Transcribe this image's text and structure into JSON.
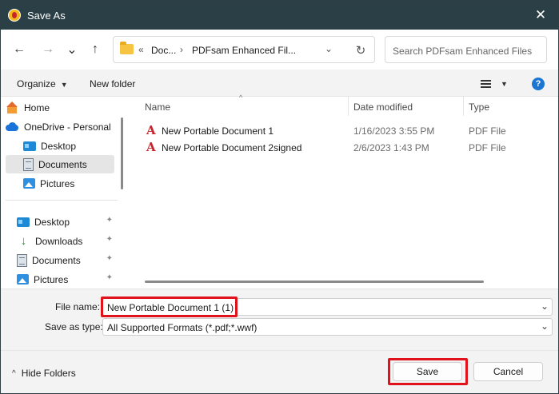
{
  "window": {
    "title": "Save As",
    "close_glyph": "✕",
    "app_icon": "pdfsam-icon"
  },
  "nav": {
    "back_glyph": "←",
    "forward_glyph": "→",
    "recent_glyph": "⌄",
    "up_glyph": "↑",
    "breadcrumb_overflow": "«",
    "breadcrumbs": [
      "Doc...",
      "PDFsam Enhanced Fil..."
    ],
    "breadcrumb_separator": "›",
    "address_dropdown_glyph": "⌄",
    "refresh_glyph": "↻",
    "search_placeholder": "Search PDFsam Enhanced Files"
  },
  "commands": {
    "organize": "Organize",
    "organize_caret": "▼",
    "new_folder": "New folder",
    "view_caret": "▼",
    "help": "?"
  },
  "sidebar": {
    "items": [
      {
        "label": "Home",
        "icon": "home-icon"
      },
      {
        "label": "OneDrive - Personal",
        "icon": "onedrive-icon"
      },
      {
        "label": "Desktop",
        "icon": "desktop-icon"
      },
      {
        "label": "Documents",
        "icon": "documents-icon",
        "selected": true
      },
      {
        "label": "Pictures",
        "icon": "pictures-icon"
      }
    ],
    "quick_access": [
      {
        "label": "Desktop",
        "icon": "desktop-icon",
        "pinned": true
      },
      {
        "label": "Downloads",
        "icon": "downloads-icon",
        "pinned": true
      },
      {
        "label": "Documents",
        "icon": "documents-icon",
        "pinned": true
      },
      {
        "label": "Pictures",
        "icon": "pictures-icon",
        "pinned": true
      }
    ],
    "pin_glyph": "📌"
  },
  "filelist": {
    "columns": [
      "Name",
      "Date modified",
      "Type"
    ],
    "sort_glyph": "^",
    "files": [
      {
        "name": "New Portable Document 1",
        "date": "1/16/2023 3:55 PM",
        "type": "PDF File",
        "icon": "pdf-icon"
      },
      {
        "name": "New Portable Document 2signed",
        "date": "2/6/2023 1:43 PM",
        "type": "PDF File",
        "icon": "pdf-icon"
      }
    ]
  },
  "form": {
    "filename_label": "File name:",
    "filename_value": "New Portable Document 1 (1)",
    "savetype_label": "Save as type:",
    "savetype_value": "All Supported Formats (*.pdf;*.wwf)",
    "combo_caret": "⌄",
    "highlight_color": "#e0121b"
  },
  "footer": {
    "hide_folders": "Hide Folders",
    "hide_glyph": "^",
    "save": "Save",
    "cancel": "Cancel"
  }
}
